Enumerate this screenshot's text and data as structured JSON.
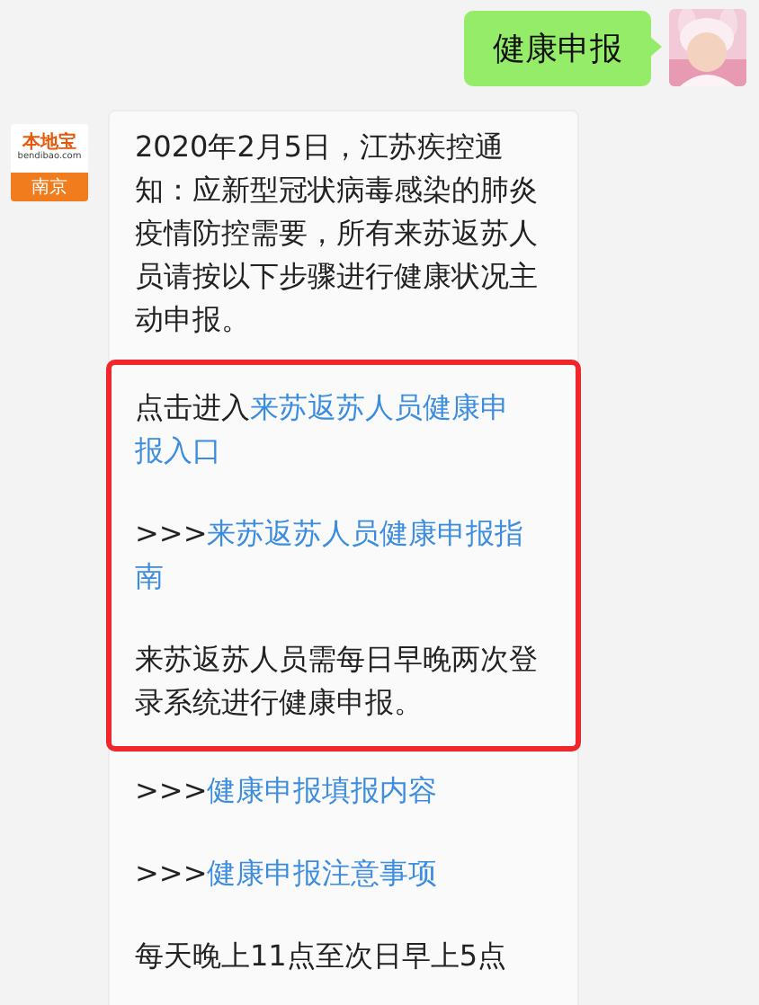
{
  "outgoing": {
    "text": "健康申报"
  },
  "incoming": {
    "logo": {
      "brand": "本地宝",
      "domain": "bendibao.com",
      "city": "南京"
    },
    "groups": [
      {
        "highlighted": false,
        "paragraphs": [
          {
            "prefix": "2020年2月5日，江苏疾控通知：应新型冠状病毒感染的肺炎疫情防控需要，所有来苏返苏人员请按以下步骤进行健康状况主动申报。"
          }
        ]
      },
      {
        "highlighted": true,
        "paragraphs": [
          {
            "prefix": "点击进入",
            "link_lines": [
              "来苏返苏人员健康申",
              "报入口"
            ]
          },
          {
            "prefix": ">>>",
            "link_lines": [
              "来苏返苏人员健康申报指",
              "南"
            ]
          },
          {
            "prefix": "来苏返苏人员需每日早晚两次登录系统进行健康申报。"
          }
        ]
      },
      {
        "highlighted": false,
        "paragraphs": [
          {
            "prefix": ">>>",
            "link_lines": [
              "健康申报填报内容"
            ]
          },
          {
            "prefix": ">>>",
            "link_lines": [
              "健康申报注意事项"
            ]
          },
          {
            "prefix": "每天晚上11点至次日早上5点"
          }
        ]
      }
    ]
  }
}
